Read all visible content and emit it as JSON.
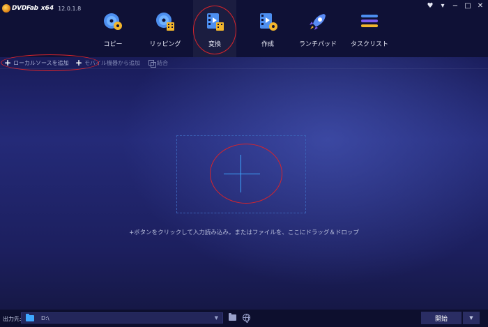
{
  "app": {
    "name": "DVDFab",
    "arch": "x64",
    "version": "12.0.1.8"
  },
  "window_controls": [
    "skin-icon",
    "menu-icon",
    "minimize-icon",
    "maximize-icon",
    "close-icon"
  ],
  "nav": {
    "items": [
      {
        "label": "コピー",
        "icon": "copy-disc-icon"
      },
      {
        "label": "リッピング",
        "icon": "ripper-disc-icon"
      },
      {
        "label": "変換",
        "icon": "converter-film-icon",
        "active": true
      },
      {
        "label": "作成",
        "icon": "creator-film-icon"
      },
      {
        "label": "ランチパッド",
        "icon": "launchpad-rocket-icon"
      },
      {
        "label": "タスクリスト",
        "icon": "task-list-icon"
      }
    ]
  },
  "toolbar": {
    "add_local": "ローカルソースを追加",
    "add_mobile": "モバイル機器から追加",
    "merge": "結合"
  },
  "dropzone": {
    "hint": "+ボタンをクリックして入力読み込み。またはファイルを、ここにドラッグ＆ドロップ"
  },
  "bottom": {
    "output_label": "出力先:",
    "output_path": "D:\\",
    "start_label": "開始"
  },
  "colors": {
    "accent": "#3ea7ff",
    "annotation": "#d8242b",
    "header_bg": "#0f1136"
  }
}
